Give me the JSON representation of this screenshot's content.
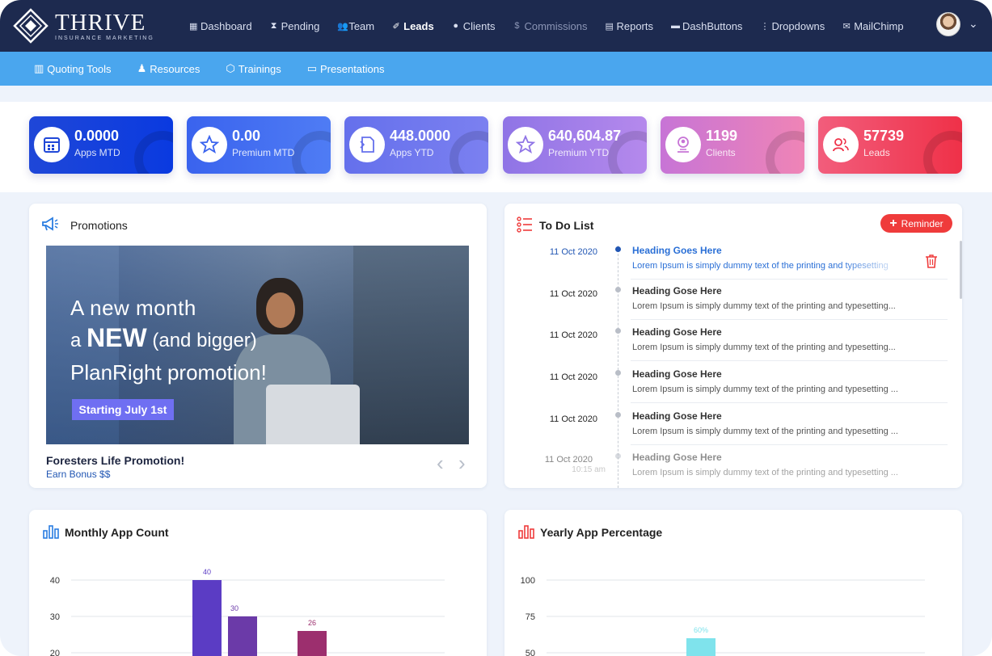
{
  "brand": {
    "name": "THRIVE",
    "tagline": "INSURANCE MARKETING"
  },
  "nav": {
    "items": [
      {
        "label": "Dashboard",
        "icon": "grid-icon"
      },
      {
        "label": "Pending",
        "icon": "hourglass-icon"
      },
      {
        "label": "Team",
        "icon": "team-icon"
      },
      {
        "label": "Leads",
        "icon": "leads-icon",
        "active": true
      },
      {
        "label": "Clients",
        "icon": "user-icon"
      },
      {
        "label": "Commissions",
        "icon": "dollar-icon",
        "muted": true
      },
      {
        "label": "Reports",
        "icon": "report-icon"
      },
      {
        "label": "DashButtons",
        "icon": "folder-icon"
      },
      {
        "label": "Dropdowns",
        "icon": "dots-vertical-icon"
      },
      {
        "label": "MailChimp",
        "icon": "mail-icon"
      }
    ]
  },
  "subnav": {
    "items": [
      {
        "label": "Quoting Tools",
        "icon": "calculator-icon"
      },
      {
        "label": "Resources",
        "icon": "resources-icon"
      },
      {
        "label": "Trainings",
        "icon": "box-icon"
      },
      {
        "label": "Presentations",
        "icon": "monitor-icon"
      }
    ]
  },
  "stats": [
    {
      "value": "0.0000",
      "label": "Apps MTD",
      "icon": "calendar-icon",
      "color": "#1f4fd6"
    },
    {
      "value": "0.00",
      "label": "Premium MTD",
      "icon": "star-icon",
      "color": "#3f6ef0"
    },
    {
      "value": "448.0000",
      "label": "Apps YTD",
      "icon": "document-icon",
      "color": "#6b73ee"
    },
    {
      "value": "640,604.87",
      "label": "Premium YTD",
      "icon": "star-icon",
      "color": "#9b7ae8"
    },
    {
      "value": "1199",
      "label": "Clients",
      "icon": "client-icon",
      "color": "#d874c6"
    },
    {
      "value": "57739",
      "label": "Leads",
      "icon": "leads-users-icon",
      "color": "#ef4a5c"
    }
  ],
  "promotions": {
    "title": "Promotions",
    "banner": {
      "line1": "A new  month",
      "line2_prefix": "a",
      "line2_bold": "NEW",
      "line2_suffix": "(and bigger)",
      "line3": "PlanRight promotion!",
      "button": "Starting July 1st"
    },
    "caption": "Foresters Life Promotion!",
    "subcaption": "Earn Bonus $$"
  },
  "todo": {
    "title": "To Do List",
    "reminder_label": "Reminder",
    "items": [
      {
        "date": "11 Oct 2020",
        "heading": "Heading Goes Here",
        "text": "Lorem Ipsum is simply dummy text of the printing and typesetting",
        "active": true
      },
      {
        "date": "11 Oct 2020",
        "heading": "Heading Gose Here",
        "text": "Lorem Ipsum is simply dummy text of the printing and typesetting..."
      },
      {
        "date": "11 Oct 2020",
        "heading": "Heading Gose Here",
        "text": "Lorem Ipsum is simply dummy text of the printing and typesetting..."
      },
      {
        "date": "11 Oct 2020",
        "heading": "Heading Gose Here",
        "text": "Lorem Ipsum is simply dummy text of the printing and typesetting ..."
      },
      {
        "date": "11 Oct 2020",
        "heading": "Heading Gose Here",
        "text": "Lorem Ipsum is simply dummy text of the printing and typesetting ..."
      },
      {
        "date": "11 Oct 2020",
        "time": "10:15 am",
        "heading": "Heading Gose Here",
        "text": "Lorem Ipsum is simply dummy text of the printing and typesetting ..."
      }
    ]
  },
  "chart_data": [
    {
      "type": "bar",
      "title": "Monthly App Count",
      "yticks": [
        20,
        30,
        40
      ],
      "ylim": [
        0,
        40
      ],
      "grid": true,
      "series": [
        {
          "values": [
            40,
            30,
            26
          ],
          "colors": [
            "#5b3cc4",
            "#6b3aa8",
            "#9c2f6e"
          ],
          "labels": [
            "40",
            "30",
            "26"
          ]
        }
      ]
    },
    {
      "type": "bar",
      "title": "Yearly App Percentage",
      "yticks": [
        50,
        75,
        100
      ],
      "ylim": [
        0,
        100
      ],
      "grid": true,
      "series": [
        {
          "values": [
            60
          ],
          "colors": [
            "#7fe3ec"
          ],
          "labels": [
            "60%"
          ]
        }
      ]
    }
  ]
}
